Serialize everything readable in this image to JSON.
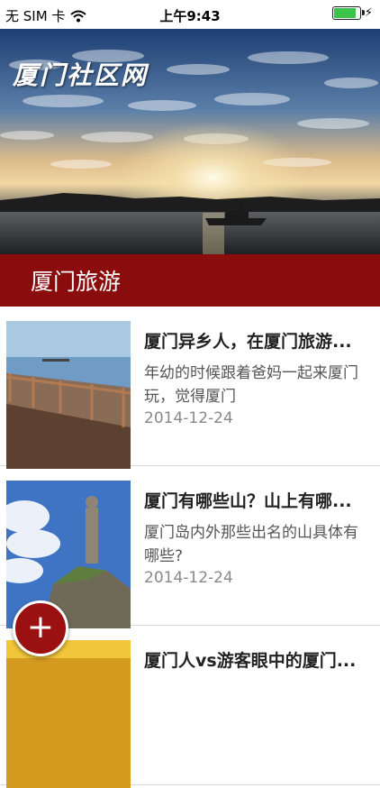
{
  "status_bar": {
    "carrier": "无 SIM 卡",
    "time": "上午9:43",
    "battery_level": 0.9
  },
  "hero": {
    "brand": "厦门社区网"
  },
  "section": {
    "title": "厦门旅游"
  },
  "articles": [
    {
      "title": "厦门异乡人，在厦门旅游...",
      "desc": "年幼的时候跟着爸妈一起来厦门玩，觉得厦门",
      "date": "2014-12-24"
    },
    {
      "title": "厦门有哪些山？山上有哪...",
      "desc": "厦门岛内外那些出名的山具体有哪些?",
      "date": "2014-12-24"
    },
    {
      "title": "厦门人vs游客眼中的厦门...",
      "desc": "",
      "date": ""
    }
  ],
  "fab": {
    "label": "+"
  },
  "colors": {
    "brand": "#8a0c0c",
    "fab": "#9b1010"
  }
}
